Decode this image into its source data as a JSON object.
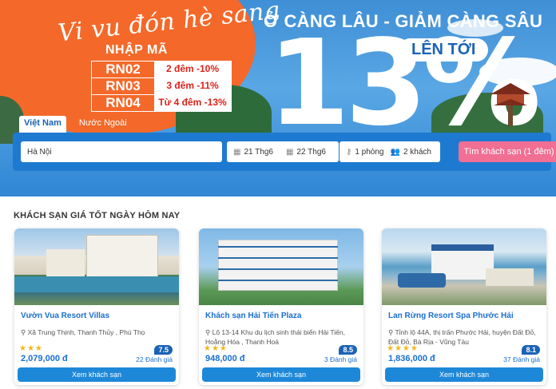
{
  "banner": {
    "slogan": "Vi vu đón hè sang",
    "promo_heading": "NHẬP MÃ",
    "codes": [
      {
        "code": "RN02",
        "desc": "2 đêm -10%"
      },
      {
        "code": "RN03",
        "desc": "3 đêm -11%"
      },
      {
        "code": "RN04",
        "desc": "Từ 4 đêm -13%"
      }
    ],
    "headline": "Ở CÀNG LÂU - GIẢM CÀNG SÂU",
    "upto": "LÊN TỚI",
    "big_number": "13",
    "percent": "%"
  },
  "search": {
    "tabs": [
      {
        "label": "Việt Nam",
        "active": true
      },
      {
        "label": "Nước Ngoài",
        "active": false
      }
    ],
    "destination": "Hà Nội",
    "checkin": "21 Thg6",
    "checkout": "22 Thg6",
    "rooms": "1 phòng",
    "guests": "2 khách",
    "button": "Tìm khách sạn (1 đêm)"
  },
  "section_title": "KHÁCH SẠN GIÁ TỐT NGÀY HÔM NAY",
  "hotels": [
    {
      "name": "Vườn Vua Resort Villas",
      "address": "Xã Trung Thịnh, Thanh Thủy , Phú Thọ",
      "stars": 3,
      "stars_text": "★★★",
      "score": "7.5",
      "price": "2,079,000 đ",
      "reviews": "22 Đánh giá",
      "button": "Xem khách sạn"
    },
    {
      "name": "Khách sạn Hải Tiến Plaza",
      "address": "Lô 13-14 Khu du lịch sinh thái biển Hải Tiến, Hoằng Hóa , Thanh Hoá",
      "stars": 3,
      "stars_text": "★★★",
      "score": "8.5",
      "price": "948,000 đ",
      "reviews": "3 Đánh giá",
      "button": "Xem khách sạn"
    },
    {
      "name": "Lan Rừng Resort Spa Phước Hải",
      "address": "Tỉnh lộ 44A, thị trấn Phước Hải, huyện Đất Đỏ, Đất Đỏ, Bà Rịa - Vũng Tàu",
      "stars": 4,
      "stars_text": "★★★★",
      "score": "8.1",
      "price": "1,836,000 đ",
      "reviews": "37 Đánh giá",
      "button": "Xem khách sạn"
    }
  ],
  "colors": {
    "brand_blue": "#1e7ad0",
    "search_button": "#f06f93",
    "banner_orange": "#f4692a",
    "link_blue": "#1a6fd0",
    "star": "#f2b619"
  }
}
